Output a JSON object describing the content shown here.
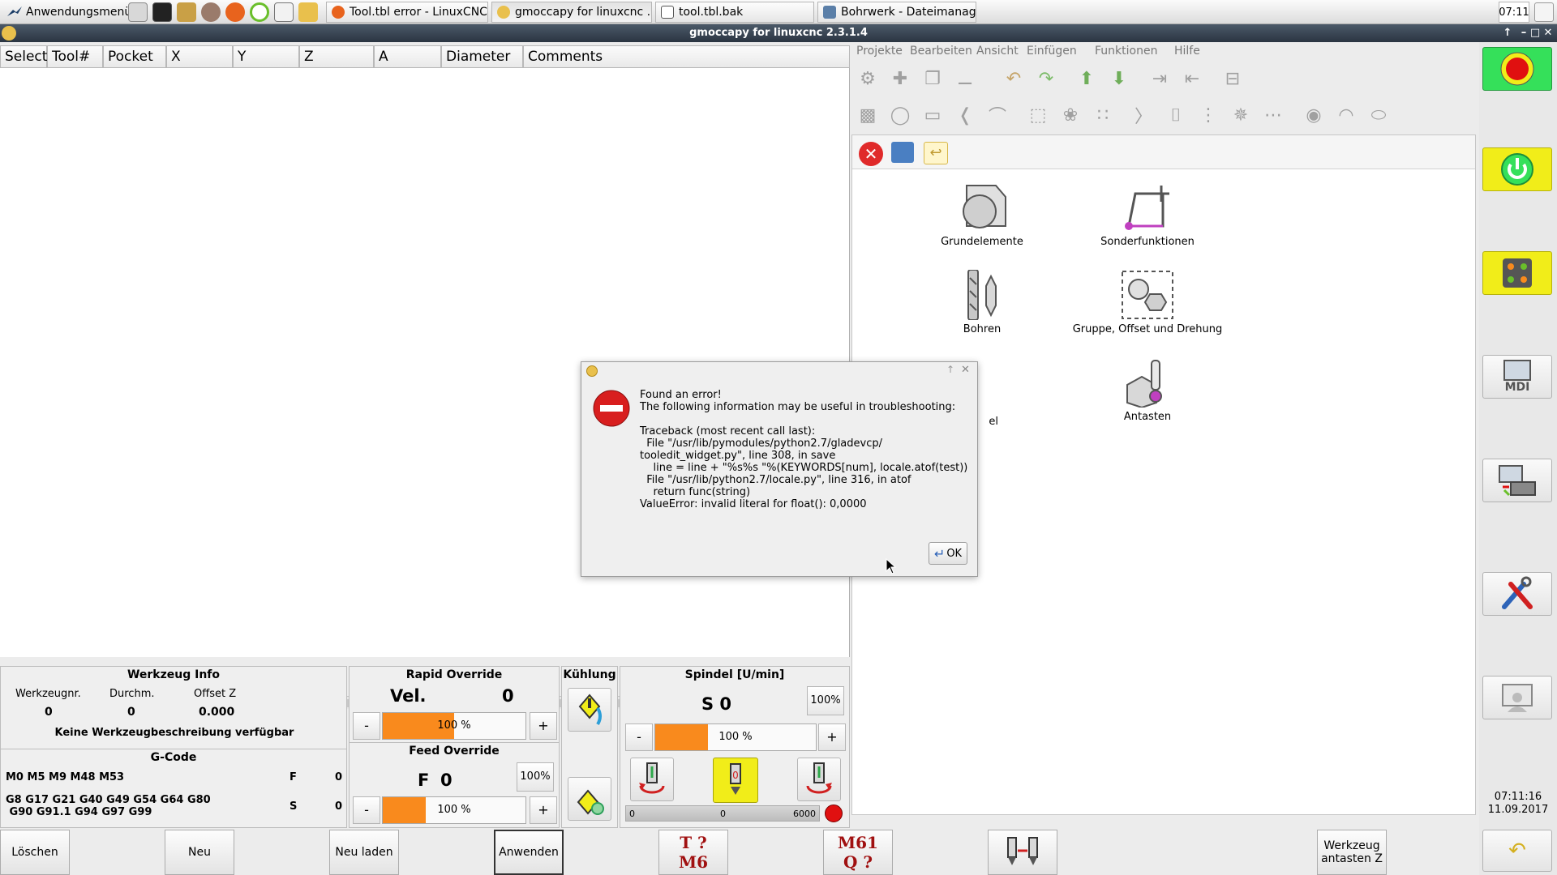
{
  "taskbar": {
    "start_label": "Anwendungsmenü",
    "tasks": [
      {
        "label": "Tool.tbl error - LinuxCNC...",
        "active": false
      },
      {
        "label": "gmoccapy for linuxcnc  ...",
        "active": true
      },
      {
        "label": "tool.tbl.bak",
        "active": false
      },
      {
        "label": "Bohrwerk - Dateimanager",
        "active": false
      }
    ],
    "clock": "07:11"
  },
  "window": {
    "title": "gmoccapy for linuxcnc  2.3.1.4"
  },
  "tool_table": {
    "columns": [
      "Select",
      "Tool#",
      "Pocket",
      "X",
      "Y",
      "Z",
      "A",
      "Diameter",
      "Comments"
    ]
  },
  "ngcgui": {
    "menu": [
      "Projekte",
      "Bearbeiten",
      "Ansicht",
      "Einfügen",
      "Funktionen",
      "Hilfe"
    ],
    "categories": [
      {
        "label": "Grundelemente",
        "icon": "basic-shapes-icon"
      },
      {
        "label": "Sonderfunktionen",
        "icon": "special-functions-icon"
      },
      {
        "label": "Bohren",
        "icon": "drill-icon"
      },
      {
        "label": "Gruppe, Offset und Drehung",
        "icon": "group-offset-rotate-icon"
      },
      {
        "label": "el",
        "icon": "hidden-category"
      },
      {
        "label": "Antasten",
        "icon": "probe-icon"
      }
    ]
  },
  "tool_info": {
    "title": "Werkzeug Info",
    "labels": {
      "tool_nr": "Werkzeugnr.",
      "diameter": "Durchm.",
      "offset_z": "Offset Z"
    },
    "values": {
      "tool_nr": "0",
      "diameter": "0",
      "offset_z": "0.000"
    },
    "description": "Keine Werkzeugbeschreibung verfügbar"
  },
  "gcode": {
    "title": "G-Code",
    "mcodes": "M0 M5 M9 M48 M53",
    "gcodes_line1": "G8 G17 G21 G40 G49 G54 G64 G80",
    "gcodes_line2": " G90 G91.1 G94 G97 G99",
    "f_label": "F",
    "f_value": "0",
    "s_label": "S",
    "s_value": "0"
  },
  "rapid_override": {
    "title": "Rapid Override",
    "label": "Vel.",
    "value": "0",
    "percent_text": "100 %",
    "fill": 0.5,
    "minus": "-",
    "plus": "+"
  },
  "feed_override": {
    "title": "Feed Override",
    "label": "F",
    "value": "0",
    "percent_text": "100 %",
    "fill": 0.3,
    "reset": "100%",
    "minus": "-",
    "plus": "+"
  },
  "coolant": {
    "title": "Kühlung"
  },
  "spindle": {
    "title": "Spindel [U/min]",
    "speed": "S 0",
    "reset": "100%",
    "percent_text": "100 %",
    "fill": 0.33,
    "minus": "-",
    "plus": "+",
    "scale_min": "0",
    "scale_mid": "0",
    "scale_max": "6000"
  },
  "bottom_buttons": {
    "delete": "Löschen",
    "new": "Neu",
    "reload": "Neu laden",
    "apply": "Anwenden",
    "tm6_line1": "T ?",
    "tm6_line2": "M6",
    "m61_line1": "M61",
    "m61_line2": "Q ?",
    "probe_z": "Werkzeug antasten Z"
  },
  "sidebar": {
    "time": "07:11:16",
    "date": "11.09.2017",
    "mdi_label": "MDI"
  },
  "dialog": {
    "message": "Found an error!\nThe following information may be useful in troubleshooting:\n\nTraceback (most recent call last):\n  File \"/usr/lib/pymodules/python2.7/gladevcp/\ntooledit_widget.py\", line 308, in save\n    line = line + \"%s%s \"%(KEYWORDS[num], locale.atof(test))\n  File \"/usr/lib/python2.7/locale.py\", line 316, in atof\n    return func(string)\nValueError: invalid literal for float(): 0,0000",
    "ok_label": "OK"
  },
  "colors": {
    "accent_orange": "#f98a1d",
    "estop_red": "#e01010",
    "power_green": "#35e05a",
    "highlight_yellow": "#f1ed19"
  }
}
